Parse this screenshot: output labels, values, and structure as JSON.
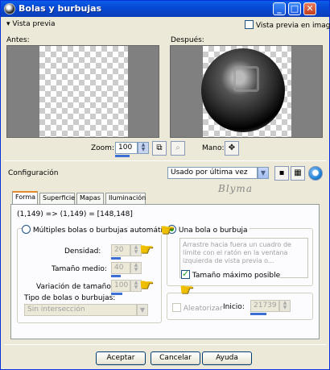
{
  "window": {
    "title": "Bolas y burbujas",
    "minimize": "_",
    "maximize": "□",
    "close": "✕"
  },
  "preview": {
    "toggle_label": "Vista previa",
    "image_preview_label": "Vista previa en imagen",
    "before_label": "Antes:",
    "after_label": "Después:",
    "zoom_label": "Zoom:",
    "zoom_value": "100",
    "hand_label": "Mano:"
  },
  "config": {
    "label": "Configuración",
    "preset_value": "Usado por última vez"
  },
  "watermark": "Blyma",
  "tabs": [
    {
      "label": "Forma",
      "active": true
    },
    {
      "label": "Superficie",
      "active": false
    },
    {
      "label": "Mapas",
      "active": false
    },
    {
      "label": "Iluminación",
      "active": false
    }
  ],
  "shape": {
    "coords": "(1,149) => (1,149) = [148,148]",
    "multiple_label": "Múltiples bolas o burbujas automáticas",
    "single_label": "Una bola o burbuja",
    "density_label": "Densidad:",
    "density_value": "20",
    "size_label": "Tamaño medio:",
    "size_value": "40",
    "variation_label": "Variación de tamaño:",
    "variation_value": "100",
    "type_label": "Tipo de bolas o burbujas:",
    "type_value": "Sin intersección",
    "hint_text": "Arrastre hacia fuera un cuadro de límite con el ratón en la ventana izquierda de vista previa o...",
    "max_size_label": "Tamaño máximo posible",
    "randomize_label": "Aleatorizar",
    "seed_label": "Inicio:",
    "seed_value": "21739"
  },
  "buttons": {
    "ok": "Aceptar",
    "cancel": "Cancelar",
    "help": "Ayuda"
  },
  "colors": {
    "titlebar": "#0749d6",
    "accent_tab": "#e68b2c",
    "check": "#21a121"
  }
}
